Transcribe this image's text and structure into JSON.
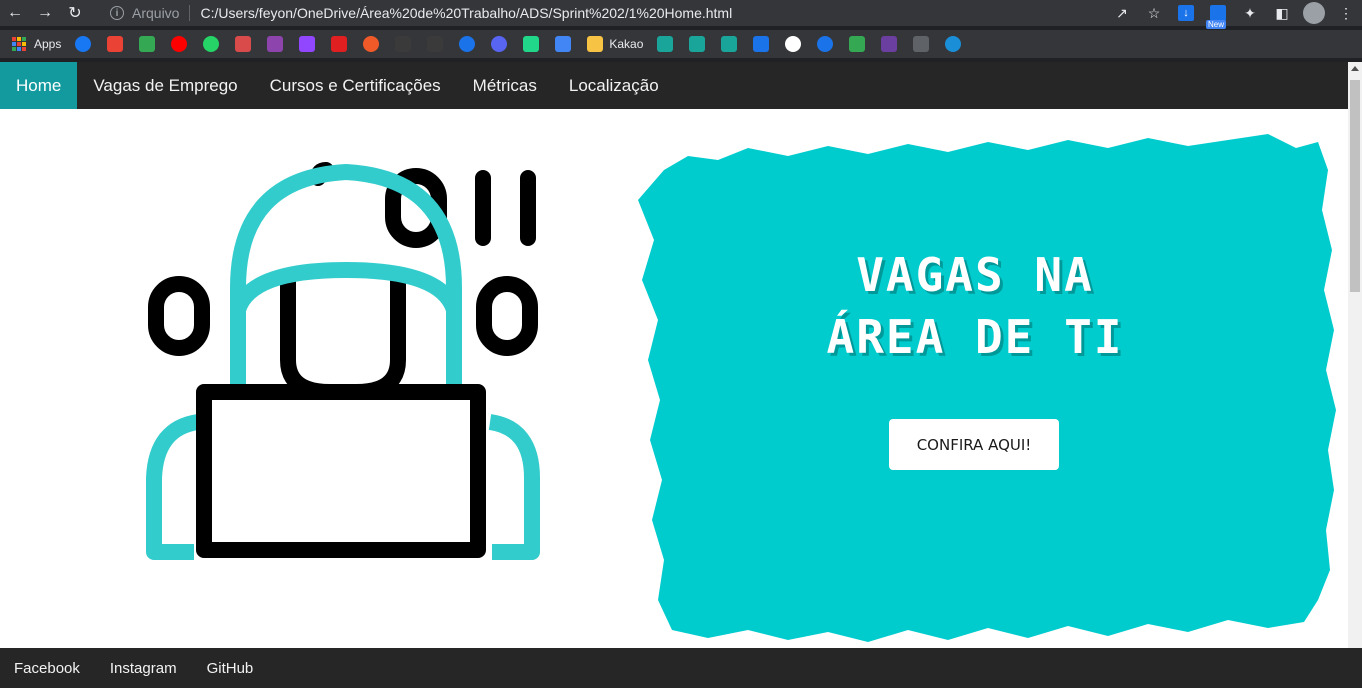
{
  "browser": {
    "scheme_label": "Arquivo",
    "url": "C:/Users/feyon/OneDrive/Área%20de%20Trabalho/ADS/Sprint%202/1%20Home.html",
    "new_badge": "New"
  },
  "bookmarks": {
    "apps_label": "Apps",
    "kakao_label": "Kakao"
  },
  "nav": {
    "items": [
      {
        "label": "Home",
        "active": true
      },
      {
        "label": "Vagas de Emprego"
      },
      {
        "label": "Cursos e Certificações"
      },
      {
        "label": "Métricas"
      },
      {
        "label": "Localização"
      }
    ]
  },
  "hero": {
    "title_line1": "VAGAS NA",
    "title_line2": "ÁREA DE TI",
    "cta_label": "CONFIRA AQUI!",
    "accent_color": "#00cccd"
  },
  "footer": {
    "links": [
      "Facebook",
      "Instagram",
      "GitHub"
    ]
  }
}
